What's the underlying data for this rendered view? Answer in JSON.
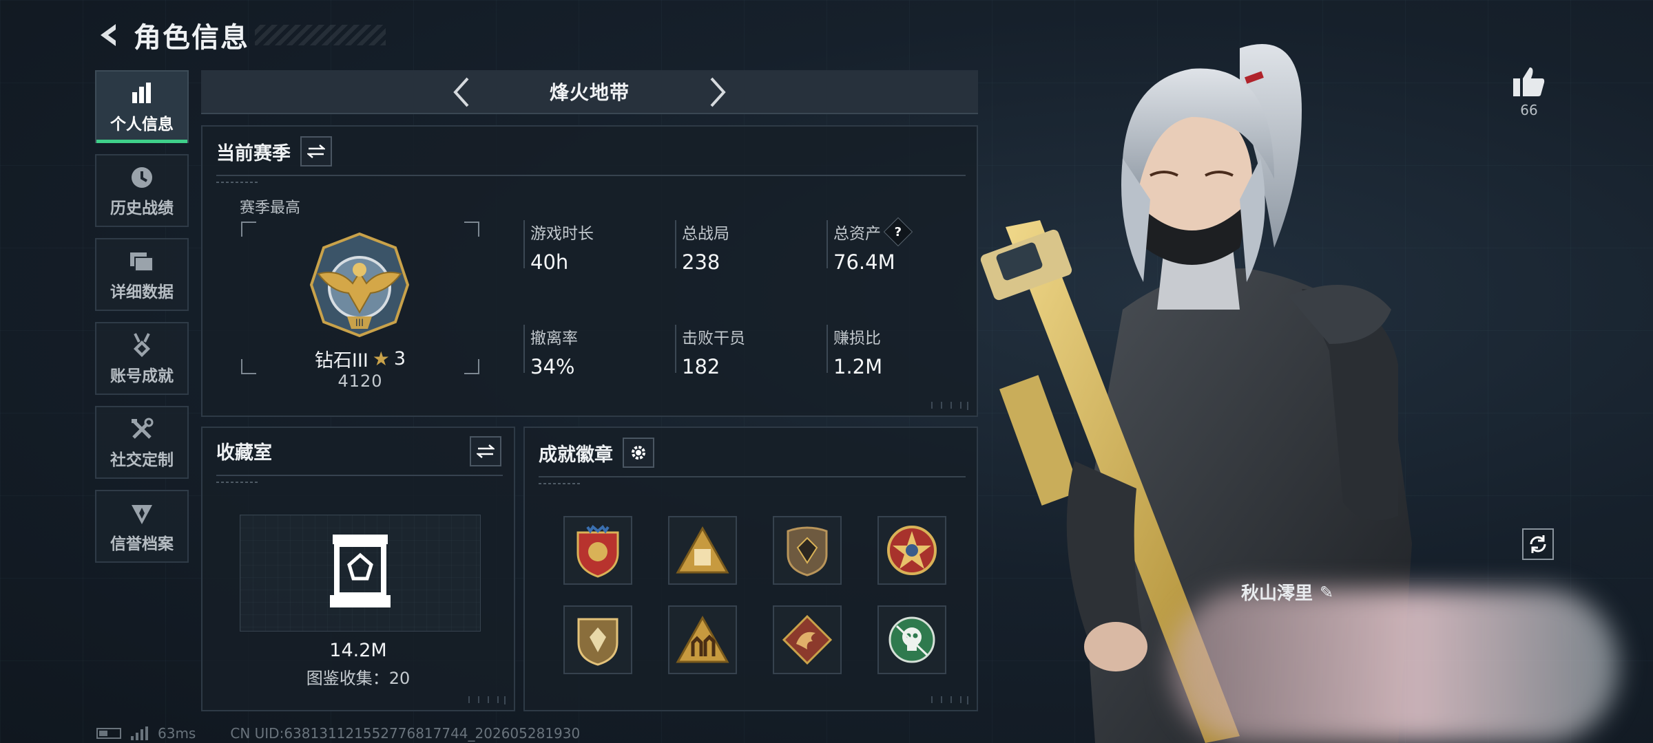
{
  "header": {
    "title": "角色信息"
  },
  "nav": {
    "items": [
      {
        "label": "个人信息",
        "icon": "bar-chart-icon",
        "active": true
      },
      {
        "label": "历史战绩",
        "icon": "clock-icon",
        "active": false
      },
      {
        "label": "详细数据",
        "icon": "folder-icon",
        "active": false
      },
      {
        "label": "账号成就",
        "icon": "medal-icon",
        "active": false
      },
      {
        "label": "社交定制",
        "icon": "tools-icon",
        "active": false
      },
      {
        "label": "信誉档案",
        "icon": "shield-icon",
        "active": false
      }
    ]
  },
  "mode": {
    "title": "烽火地带"
  },
  "season": {
    "title": "当前赛季",
    "best_label": "赛季最高",
    "rank_name": "钻石III",
    "rank_stars": "3",
    "rank_score": "4120",
    "stats": [
      {
        "label": "游戏时长",
        "value": "40h"
      },
      {
        "label": "总战局",
        "value": "238"
      },
      {
        "label": "总资产",
        "value": "76.4M",
        "help": "?"
      },
      {
        "label": "撤离率",
        "value": "34%"
      },
      {
        "label": "击败干员",
        "value": "182"
      },
      {
        "label": "赚损比",
        "value": "1.2M"
      }
    ]
  },
  "collection": {
    "title": "收藏室",
    "value": "14.2M",
    "count_text": "图鉴收集：20"
  },
  "badges": {
    "title": "成就徽章",
    "items": [
      "shield-star-badge",
      "pyramid-badge",
      "gem-shield-badge",
      "cross-star-badge",
      "emblem-shield-badge",
      "soldiers-badge",
      "dragon-badge",
      "skull-badge"
    ]
  },
  "character": {
    "name": "秋山澪里",
    "likes": "66"
  },
  "footer": {
    "ping": "63ms",
    "uid": "CN UID:638131121552776817744_202605281930"
  },
  "colors": {
    "accent": "#3fd08a",
    "gold": "#c9a24a",
    "background": "#141c25"
  }
}
